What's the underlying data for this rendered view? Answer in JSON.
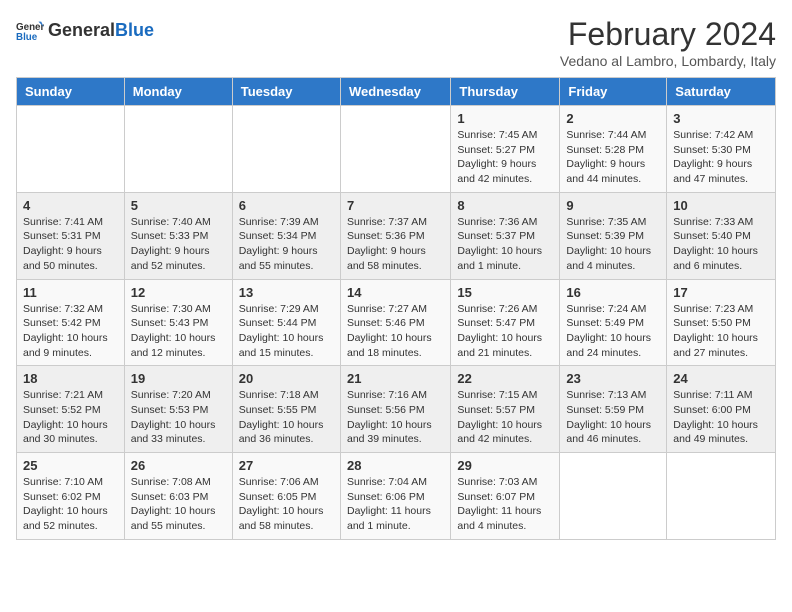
{
  "logo": {
    "general": "General",
    "blue": "Blue"
  },
  "title": "February 2024",
  "subtitle": "Vedano al Lambro, Lombardy, Italy",
  "days_header": [
    "Sunday",
    "Monday",
    "Tuesday",
    "Wednesday",
    "Thursday",
    "Friday",
    "Saturday"
  ],
  "weeks": [
    [
      {
        "day": "",
        "info": ""
      },
      {
        "day": "",
        "info": ""
      },
      {
        "day": "",
        "info": ""
      },
      {
        "day": "",
        "info": ""
      },
      {
        "day": "1",
        "info": "Sunrise: 7:45 AM\nSunset: 5:27 PM\nDaylight: 9 hours\nand 42 minutes."
      },
      {
        "day": "2",
        "info": "Sunrise: 7:44 AM\nSunset: 5:28 PM\nDaylight: 9 hours\nand 44 minutes."
      },
      {
        "day": "3",
        "info": "Sunrise: 7:42 AM\nSunset: 5:30 PM\nDaylight: 9 hours\nand 47 minutes."
      }
    ],
    [
      {
        "day": "4",
        "info": "Sunrise: 7:41 AM\nSunset: 5:31 PM\nDaylight: 9 hours\nand 50 minutes."
      },
      {
        "day": "5",
        "info": "Sunrise: 7:40 AM\nSunset: 5:33 PM\nDaylight: 9 hours\nand 52 minutes."
      },
      {
        "day": "6",
        "info": "Sunrise: 7:39 AM\nSunset: 5:34 PM\nDaylight: 9 hours\nand 55 minutes."
      },
      {
        "day": "7",
        "info": "Sunrise: 7:37 AM\nSunset: 5:36 PM\nDaylight: 9 hours\nand 58 minutes."
      },
      {
        "day": "8",
        "info": "Sunrise: 7:36 AM\nSunset: 5:37 PM\nDaylight: 10 hours\nand 1 minute."
      },
      {
        "day": "9",
        "info": "Sunrise: 7:35 AM\nSunset: 5:39 PM\nDaylight: 10 hours\nand 4 minutes."
      },
      {
        "day": "10",
        "info": "Sunrise: 7:33 AM\nSunset: 5:40 PM\nDaylight: 10 hours\nand 6 minutes."
      }
    ],
    [
      {
        "day": "11",
        "info": "Sunrise: 7:32 AM\nSunset: 5:42 PM\nDaylight: 10 hours\nand 9 minutes."
      },
      {
        "day": "12",
        "info": "Sunrise: 7:30 AM\nSunset: 5:43 PM\nDaylight: 10 hours\nand 12 minutes."
      },
      {
        "day": "13",
        "info": "Sunrise: 7:29 AM\nSunset: 5:44 PM\nDaylight: 10 hours\nand 15 minutes."
      },
      {
        "day": "14",
        "info": "Sunrise: 7:27 AM\nSunset: 5:46 PM\nDaylight: 10 hours\nand 18 minutes."
      },
      {
        "day": "15",
        "info": "Sunrise: 7:26 AM\nSunset: 5:47 PM\nDaylight: 10 hours\nand 21 minutes."
      },
      {
        "day": "16",
        "info": "Sunrise: 7:24 AM\nSunset: 5:49 PM\nDaylight: 10 hours\nand 24 minutes."
      },
      {
        "day": "17",
        "info": "Sunrise: 7:23 AM\nSunset: 5:50 PM\nDaylight: 10 hours\nand 27 minutes."
      }
    ],
    [
      {
        "day": "18",
        "info": "Sunrise: 7:21 AM\nSunset: 5:52 PM\nDaylight: 10 hours\nand 30 minutes."
      },
      {
        "day": "19",
        "info": "Sunrise: 7:20 AM\nSunset: 5:53 PM\nDaylight: 10 hours\nand 33 minutes."
      },
      {
        "day": "20",
        "info": "Sunrise: 7:18 AM\nSunset: 5:55 PM\nDaylight: 10 hours\nand 36 minutes."
      },
      {
        "day": "21",
        "info": "Sunrise: 7:16 AM\nSunset: 5:56 PM\nDaylight: 10 hours\nand 39 minutes."
      },
      {
        "day": "22",
        "info": "Sunrise: 7:15 AM\nSunset: 5:57 PM\nDaylight: 10 hours\nand 42 minutes."
      },
      {
        "day": "23",
        "info": "Sunrise: 7:13 AM\nSunset: 5:59 PM\nDaylight: 10 hours\nand 46 minutes."
      },
      {
        "day": "24",
        "info": "Sunrise: 7:11 AM\nSunset: 6:00 PM\nDaylight: 10 hours\nand 49 minutes."
      }
    ],
    [
      {
        "day": "25",
        "info": "Sunrise: 7:10 AM\nSunset: 6:02 PM\nDaylight: 10 hours\nand 52 minutes."
      },
      {
        "day": "26",
        "info": "Sunrise: 7:08 AM\nSunset: 6:03 PM\nDaylight: 10 hours\nand 55 minutes."
      },
      {
        "day": "27",
        "info": "Sunrise: 7:06 AM\nSunset: 6:05 PM\nDaylight: 10 hours\nand 58 minutes."
      },
      {
        "day": "28",
        "info": "Sunrise: 7:04 AM\nSunset: 6:06 PM\nDaylight: 11 hours\nand 1 minute."
      },
      {
        "day": "29",
        "info": "Sunrise: 7:03 AM\nSunset: 6:07 PM\nDaylight: 11 hours\nand 4 minutes."
      },
      {
        "day": "",
        "info": ""
      },
      {
        "day": "",
        "info": ""
      }
    ]
  ]
}
